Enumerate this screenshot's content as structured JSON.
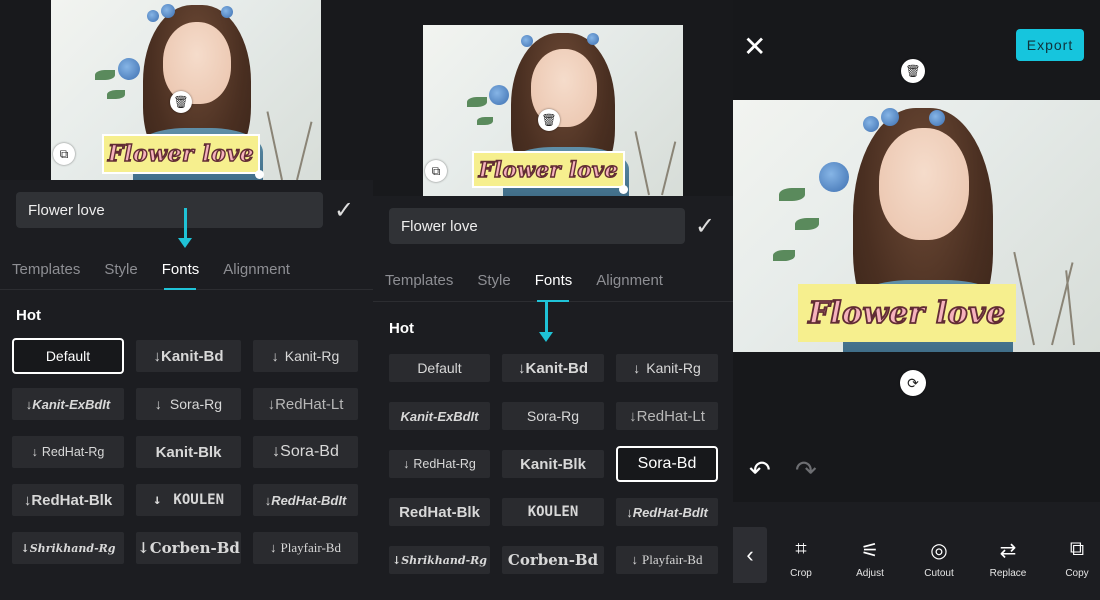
{
  "overlay_text": "Flower love",
  "input_value": "Flower love",
  "tabs": [
    "Templates",
    "Style",
    "Fonts",
    "Alignment"
  ],
  "active_tab": "Fonts",
  "section_label": "Hot",
  "fonts": [
    "Default",
    "Kanit-Bd",
    "Kanit-Rg",
    "Kanit-ExBdIt",
    "Sora-Rg",
    "RedHat-Lt",
    "RedHat-Rg",
    "Kanit-Blk",
    "Sora-Bd",
    "RedHat-Blk",
    "KOULEN",
    "RedHat-BdIt",
    "Shrikhand-Rg",
    "Corben-Bd",
    "Playfair-Bd"
  ],
  "download_icon": "↓",
  "panel1_selected_font": "Default",
  "panel2_selected_font": "Sora-Bd",
  "export_label": "Export",
  "tools": [
    {
      "label": "Crop",
      "icon": "crop-icon"
    },
    {
      "label": "Adjust",
      "icon": "sliders-icon"
    },
    {
      "label": "Cutout",
      "icon": "cutout-icon"
    },
    {
      "label": "Replace",
      "icon": "replace-icon"
    },
    {
      "label": "Copy",
      "icon": "copy-icon"
    }
  ],
  "colors": {
    "accent": "#20c4d8",
    "text_box_bg": "#f6ef8e",
    "text_fill": "#f5b2bc",
    "text_outline": "#612c34"
  }
}
